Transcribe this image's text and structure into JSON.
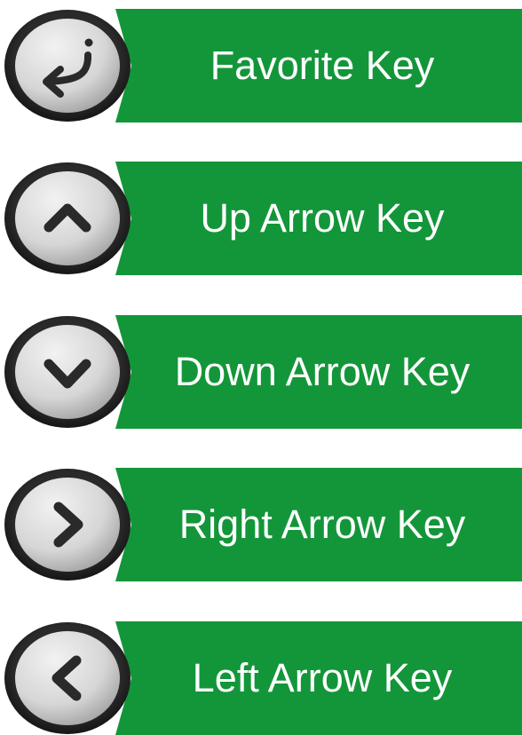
{
  "keys": [
    {
      "label": "Favorite Key",
      "icon": "return-arrow-icon"
    },
    {
      "label": "Up Arrow Key",
      "icon": "chevron-up-icon"
    },
    {
      "label": "Down Arrow Key",
      "icon": "chevron-down-icon"
    },
    {
      "label": "Right Arrow Key",
      "icon": "chevron-right-icon"
    },
    {
      "label": "Left Arrow Key",
      "icon": "chevron-left-icon"
    }
  ],
  "colors": {
    "banner": "#139639",
    "button_face": "#d9d9d9",
    "button_ring": "#1a1a1a",
    "glyph": "#2a2a2a"
  }
}
